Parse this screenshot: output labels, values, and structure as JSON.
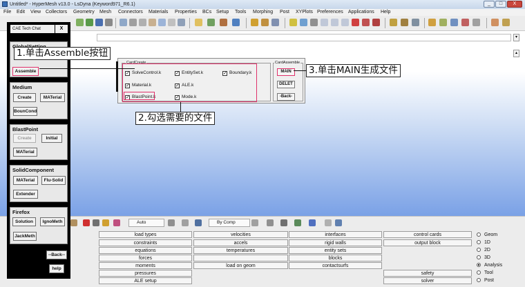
{
  "window": {
    "title": "Untitled* - HyperMesh v13.0 - LsDyna (Keyword971_R6.1)",
    "minimize": "_",
    "maximize": "□",
    "close": "X"
  },
  "menu": [
    "File",
    "Edit",
    "View",
    "Collectors",
    "Geometry",
    "Mesh",
    "Connectors",
    "Materials",
    "Properties",
    "BCs",
    "Setup",
    "Tools",
    "Morphing",
    "Post",
    "XYPlots",
    "Preferences",
    "Applications",
    "Help"
  ],
  "lower_toolbar": {
    "auto_label": "Auto",
    "by_comp_label": "By Comp"
  },
  "panel_buttons": {
    "col1": [
      "load types",
      "constraints",
      "equations",
      "forces",
      "moments",
      "pressures",
      "ALE setup"
    ],
    "col2": [
      "velocities",
      "accels",
      "temperatures",
      "",
      "load on geom"
    ],
    "col3": [
      "interfaces",
      "rigid walls",
      "entity sets",
      "blocks",
      "contactsurfs"
    ],
    "col4": [
      "control cards",
      "output block"
    ],
    "col5": [
      "safety",
      "solver"
    ]
  },
  "radio_options": [
    {
      "label": "Geom",
      "selected": false
    },
    {
      "label": "1D",
      "selected": false
    },
    {
      "label": "2D",
      "selected": false
    },
    {
      "label": "3D",
      "selected": false
    },
    {
      "label": "Analysis",
      "selected": true
    },
    {
      "label": "Tool",
      "selected": false
    },
    {
      "label": "Post",
      "selected": false
    }
  ],
  "cae_panel": {
    "title": "CAE Tech Chat",
    "close_label": "X",
    "global_setting": {
      "title": "GlobalSetting",
      "assemble": "Assemble"
    },
    "medium": {
      "title": "Medium",
      "create": "Create",
      "material": "MATerial",
      "boun_cond": "BounCond"
    },
    "blast_point": {
      "title": "BlastPoint",
      "create": "Create",
      "initial": "Initial",
      "material": "MATerial"
    },
    "solid_component": {
      "title": "SolidComponent",
      "material": "MATerial",
      "flu_solid": "Flu-Solid",
      "extender": "Extender"
    },
    "firefox": {
      "title": "Firefox",
      "solution": "Solution",
      "igno_meth": "IgnoMeth",
      "jack_meth": "JackMeth"
    },
    "back": "--Back--",
    "help": "help"
  },
  "card_window": {
    "card_create": {
      "title": "CardCreate",
      "items": [
        {
          "label": "SolveControl.k",
          "checked": true
        },
        {
          "label": "EntitySet.k",
          "checked": true
        },
        {
          "label": "Boundary.k",
          "checked": true
        },
        {
          "label": "Material.k",
          "checked": true
        },
        {
          "label": "ALE.k",
          "checked": true
        },
        {
          "label": "BlastPoint.k",
          "checked": true
        },
        {
          "label": "Mode.k",
          "checked": true
        }
      ]
    },
    "card_assemble": {
      "title": "CardAssemble",
      "main": "MAIN",
      "delet": "DELET",
      "back": "-Back-"
    }
  },
  "annotations": {
    "step1": "1.单击Assemble按钮",
    "step2": "2.勾选需要的文件",
    "step3": "3.单击MAIN生成文件"
  },
  "colors": {
    "highlight": "#e0306a",
    "graphics_gradient_bottom": "#7aa1e6"
  }
}
